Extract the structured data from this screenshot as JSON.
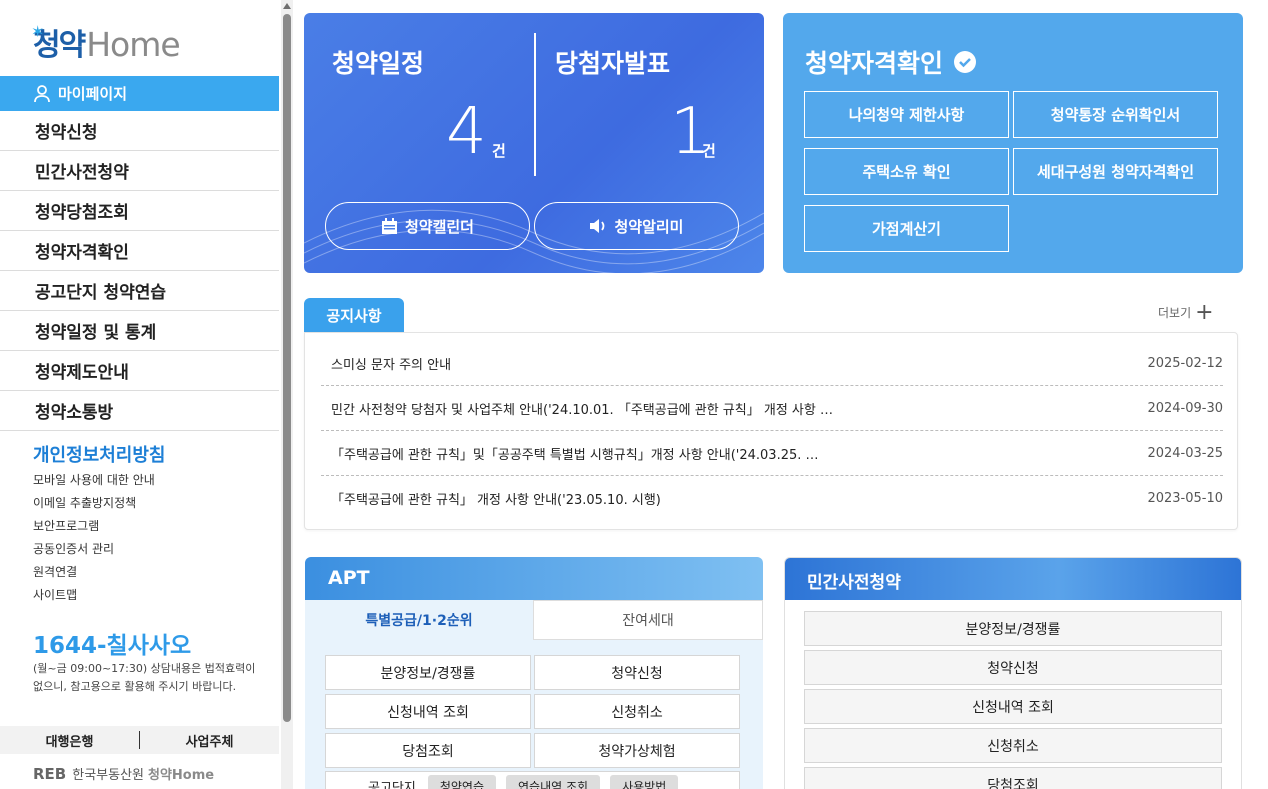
{
  "sidebar": {
    "logo": {
      "part1": "청약",
      "part2": "Home"
    },
    "mypage": "마이페이지",
    "menu": [
      "청약신청",
      "민간사전청약",
      "청약당첨조회",
      "청약자격확인",
      "공고단지 청약연습",
      "청약일정 및 통계",
      "청약제도안내",
      "청약소통방"
    ],
    "policy": "개인정보처리방침",
    "links": [
      "모바일 사용에 대한 안내",
      "이메일 추출방지정책",
      "보안프로그램",
      "공동인증서 관리",
      "원격연결",
      "사이트맵"
    ],
    "phone": "1644-칠사사오",
    "phone_note": "(월~금 09:00~17:30) 상담내용은 법적효력이 없으니, 참고용으로 활용해 주시기 바랍니다.",
    "banks": [
      "대행은행",
      "사업주체"
    ],
    "footer": {
      "reb": "REB",
      "org": "한국부동산원",
      "brand": "청약Home"
    }
  },
  "schedule": {
    "title_left": "청약일정",
    "title_right": "당첨자발표",
    "count_left": "4",
    "count_right": "1",
    "unit": "건",
    "btn_calendar": "청약캘린더",
    "btn_alarm": "청약알리미"
  },
  "qualify": {
    "title": "청약자격확인",
    "buttons": [
      "나의청약 제한사항",
      "청약통장 순위확인서",
      "주택소유 확인",
      "세대구성원 청약자격확인",
      "가점계산기"
    ]
  },
  "notice": {
    "tab": "공지사항",
    "more": "더보기",
    "items": [
      {
        "title": "스미싱 문자 주의 안내",
        "date": "2025-02-12"
      },
      {
        "title": "민간 사전청약 당첨자 및 사업주체 안내('24.10.01. 「주택공급에 관한 규칙」 개정 사항 …",
        "date": "2024-09-30"
      },
      {
        "title": "「주택공급에 관한 규칙」및「공공주택 특별법 시행규칙」개정 사항 안내('24.03.25. …",
        "date": "2024-03-25"
      },
      {
        "title": "「주택공급에 관한 규칙」 개정 사항 안내('23.05.10. 시행)",
        "date": "2023-05-10"
      }
    ]
  },
  "apt": {
    "title": "APT",
    "tab_active": "특별공급/1·2순위",
    "tab_inactive": "잔여세대",
    "buttons": [
      "분양정보/경쟁률",
      "청약신청",
      "신청내역 조회",
      "신청취소",
      "당첨조회",
      "청약가상체험"
    ],
    "gongo_label": "공고단지",
    "gongo_chips": [
      "청약연습",
      "연습내역 조회",
      "사용방법"
    ]
  },
  "private": {
    "title": "민간사전청약",
    "buttons": [
      "분양정보/경쟁률",
      "청약신청",
      "신청내역 조회",
      "신청취소",
      "당첨조회"
    ]
  }
}
